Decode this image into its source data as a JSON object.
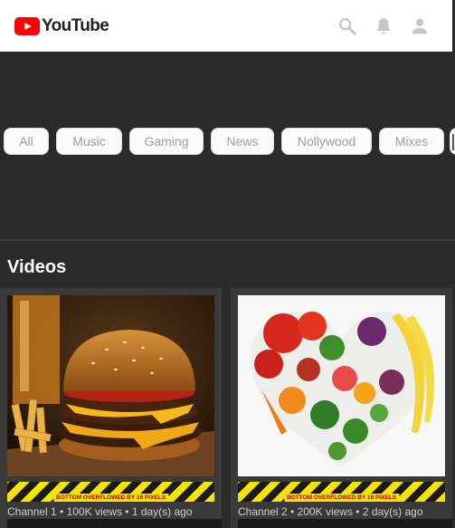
{
  "app": {
    "logo_text": "YouTube",
    "brand_color": "#ff0000",
    "icons": [
      "search-icon",
      "notifications-icon",
      "account-icon"
    ]
  },
  "tabs": [
    {
      "label": "All"
    },
    {
      "label": "Music"
    },
    {
      "label": "Gaming"
    },
    {
      "label": "News"
    },
    {
      "label": "Nollywood"
    },
    {
      "label": "Mixes"
    }
  ],
  "section": {
    "title": "Videos"
  },
  "videos": [
    {
      "thumbnail": "burger-and-fries-photo",
      "meta": "Channel 1 • 100K views • 1 day(s) ago"
    },
    {
      "thumbnail": "fruit-vegetable-heart-photo",
      "meta": "Channel 2 • 200K views • 2 day(s) ago"
    }
  ],
  "debug": {
    "overflow_text": "BOTTOM OVERFLOWED BY 19 PIXELS",
    "stripe_colors": [
      "#f5e400",
      "#1a1a1a"
    ]
  }
}
